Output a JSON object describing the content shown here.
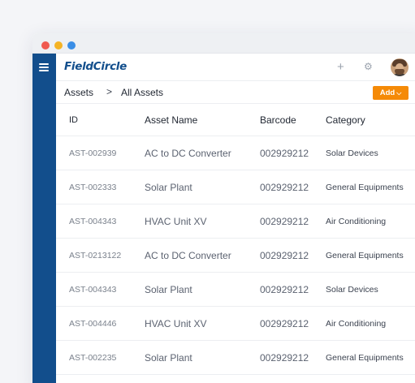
{
  "app": {
    "logo": "FieldCircle",
    "toolbar": {
      "plus_icon": "plus-icon",
      "gear_icon": "gear-icon",
      "avatar": "user-avatar"
    }
  },
  "breadcrumb": {
    "items": [
      "Assets",
      "All Assets"
    ],
    "separator": ">"
  },
  "add_button": {
    "label": "Add",
    "icon": "chevron-down-icon"
  },
  "table": {
    "columns": [
      "ID",
      "Asset Name",
      "Barcode",
      "Category"
    ],
    "rows": [
      {
        "id": "AST-002939",
        "name": "AC to DC Converter",
        "barcode": "002929212",
        "category": "Solar Devices"
      },
      {
        "id": "AST-002333",
        "name": "Solar Plant",
        "barcode": "002929212",
        "category": "General Equipments"
      },
      {
        "id": "AST-004343",
        "name": "HVAC Unit XV",
        "barcode": "002929212",
        "category": "Air Conditioning"
      },
      {
        "id": "AST-0213122",
        "name": "AC to DC Converter",
        "barcode": "002929212",
        "category": "General Equipments"
      },
      {
        "id": "AST-004343",
        "name": "Solar Plant",
        "barcode": "002929212",
        "category": "Solar Devices"
      },
      {
        "id": "AST-004446",
        "name": "HVAC Unit XV",
        "barcode": "002929212",
        "category": "Air Conditioning"
      },
      {
        "id": "AST-002235",
        "name": "Solar Plant",
        "barcode": "002929212",
        "category": "General Equipments"
      }
    ]
  },
  "colors": {
    "sidebar": "#124e8c",
    "brand": "#124e8c",
    "accent": "#f58a07",
    "window_dots": [
      "#f05a50",
      "#f5b324",
      "#3a8ee6"
    ]
  }
}
